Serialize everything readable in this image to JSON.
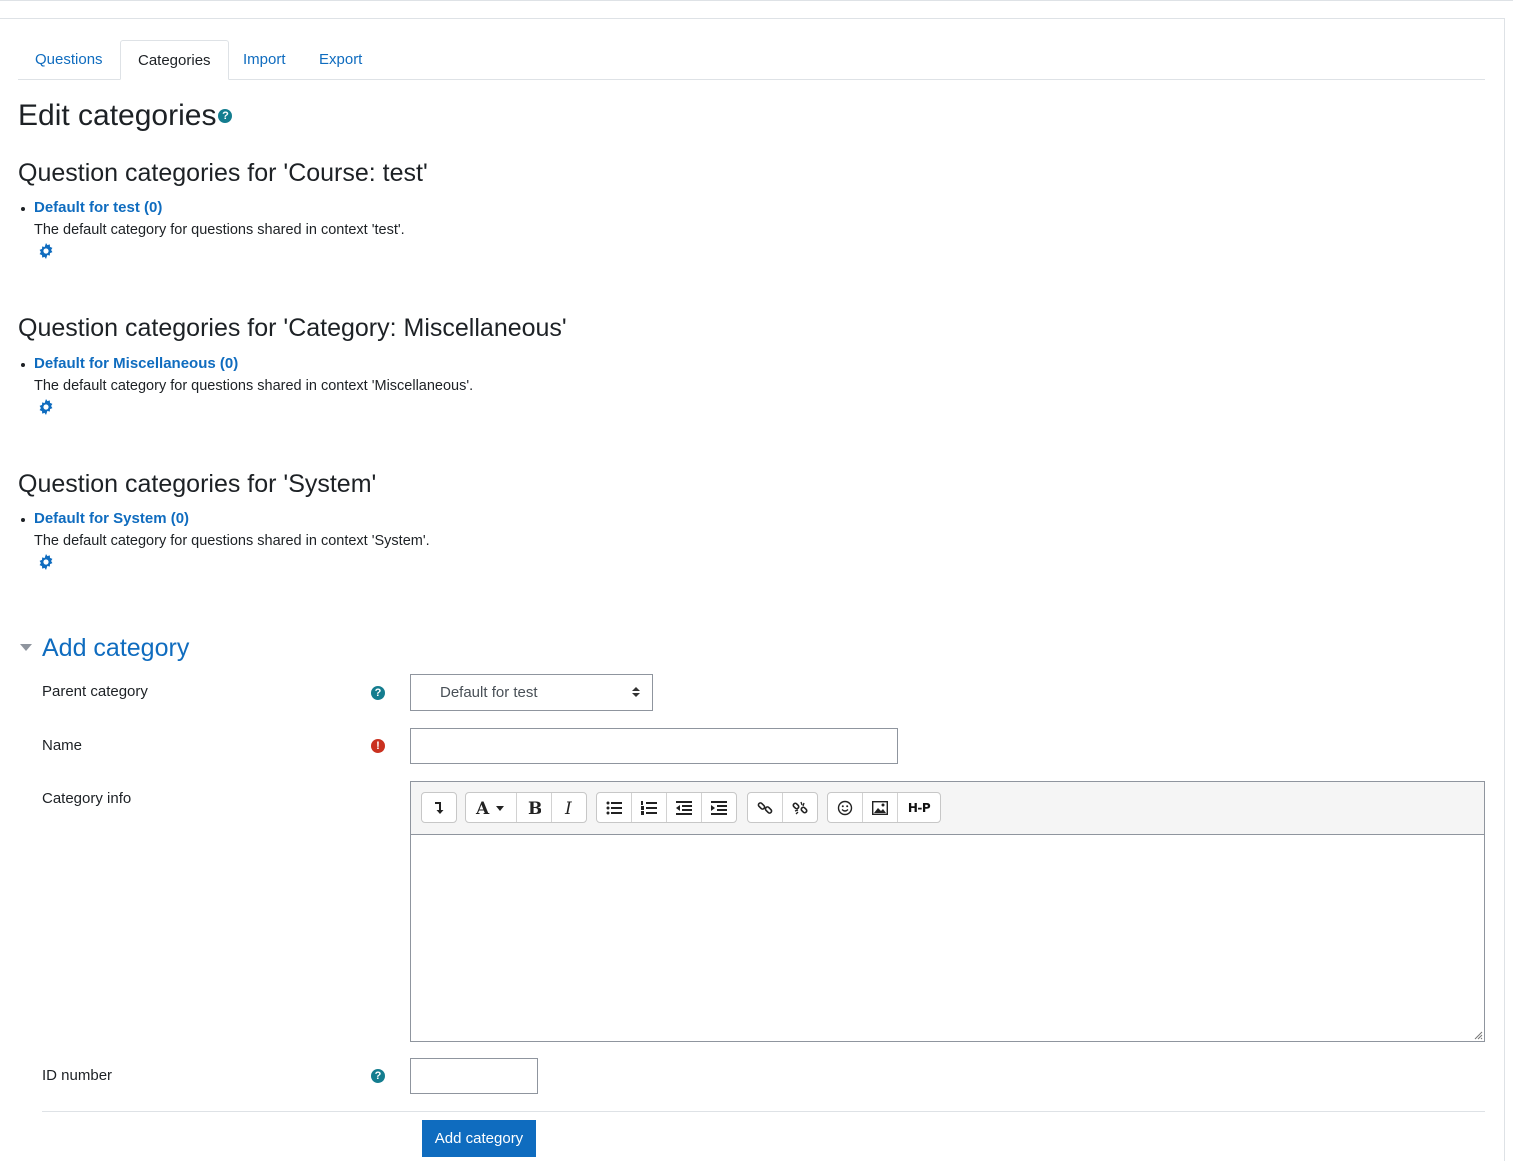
{
  "tabs": [
    {
      "label": "Questions",
      "active": false
    },
    {
      "label": "Categories",
      "active": true
    },
    {
      "label": "Import",
      "active": false
    },
    {
      "label": "Export",
      "active": false
    }
  ],
  "page_title": "Edit categories",
  "contexts": [
    {
      "heading": "Question categories for 'Course: test'",
      "category": "Default for test (0)",
      "description": "The default category for questions shared in context 'test'."
    },
    {
      "heading": "Question categories for 'Category: Miscellaneous'",
      "category": "Default for Miscellaneous (0)",
      "description": "The default category for questions shared in context 'Miscellaneous'."
    },
    {
      "heading": "Question categories for 'System'",
      "category": "Default for System (0)",
      "description": "The default category for questions shared in context 'System'."
    }
  ],
  "add_category": {
    "heading": "Add category",
    "parent_label": "Parent category",
    "parent_value": "Default for test",
    "name_label": "Name",
    "name_value": "",
    "info_label": "Category info",
    "idnumber_label": "ID number",
    "idnumber_value": "",
    "submit_label": "Add category"
  },
  "editor_toolbar": {
    "h5p_label": "H-P"
  },
  "colors": {
    "link": "#0f6cbf",
    "help": "#147d8f",
    "required": "#ca3120",
    "button": "#0f6cbf"
  }
}
